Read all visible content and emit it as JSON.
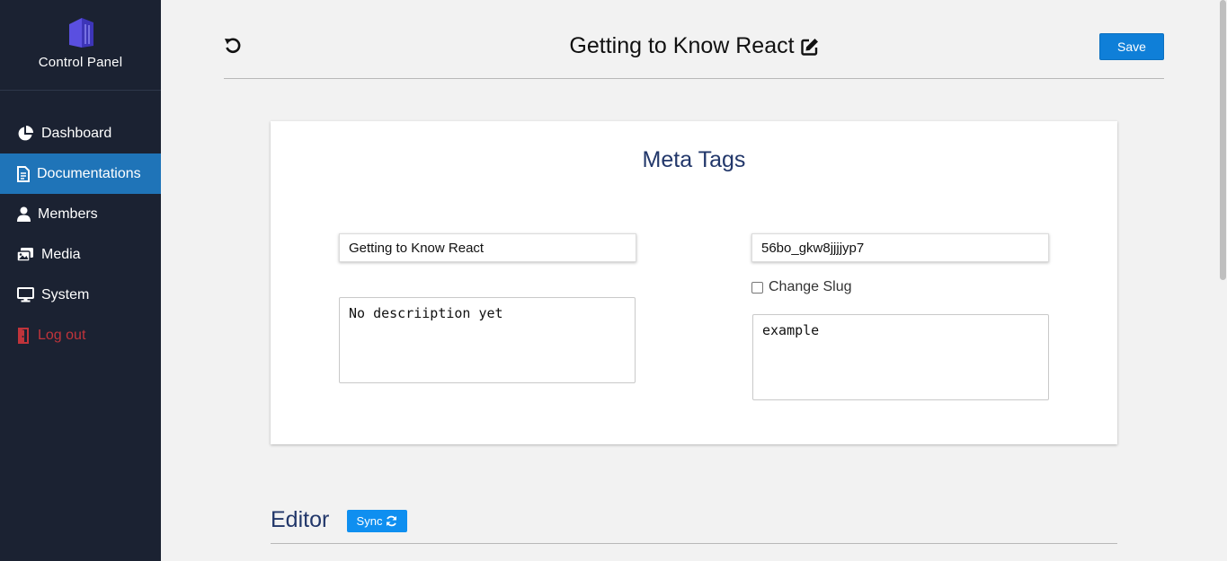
{
  "brand": {
    "name": "Control Panel",
    "logo_icon": "building-logo-icon",
    "logo_color": "#5a4fe0"
  },
  "sidebar": {
    "items": [
      {
        "label": "Dashboard",
        "icon": "pie-chart-icon"
      },
      {
        "label": "Documentations",
        "icon": "document-icon",
        "active": true
      },
      {
        "label": "Members",
        "icon": "user-icon"
      },
      {
        "label": "Media",
        "icon": "images-icon"
      },
      {
        "label": "System",
        "icon": "monitor-icon"
      },
      {
        "label": "Log out",
        "icon": "door-icon",
        "color": "#c0343b"
      }
    ]
  },
  "header": {
    "title": "Getting to Know React",
    "save_label": "Save",
    "reset_icon": "undo-icon",
    "edit_icon": "edit-icon"
  },
  "meta": {
    "title": "Meta Tags",
    "title_value": "Getting to Know React",
    "description_value": "No descriiption yet",
    "slug_value": "56bo_gkw8jjjjyp7",
    "change_slug_label": "Change Slug",
    "change_slug_checked": false,
    "keywords_value": "example"
  },
  "editor": {
    "title": "Editor",
    "sync_label": "Sync",
    "sync_icon": "refresh-icon"
  },
  "colors": {
    "sidebar_bg": "#1b2232",
    "active_bg": "#1f74b8",
    "accent": "#0f7fd8",
    "heading": "#22376a",
    "danger": "#c0343b"
  }
}
